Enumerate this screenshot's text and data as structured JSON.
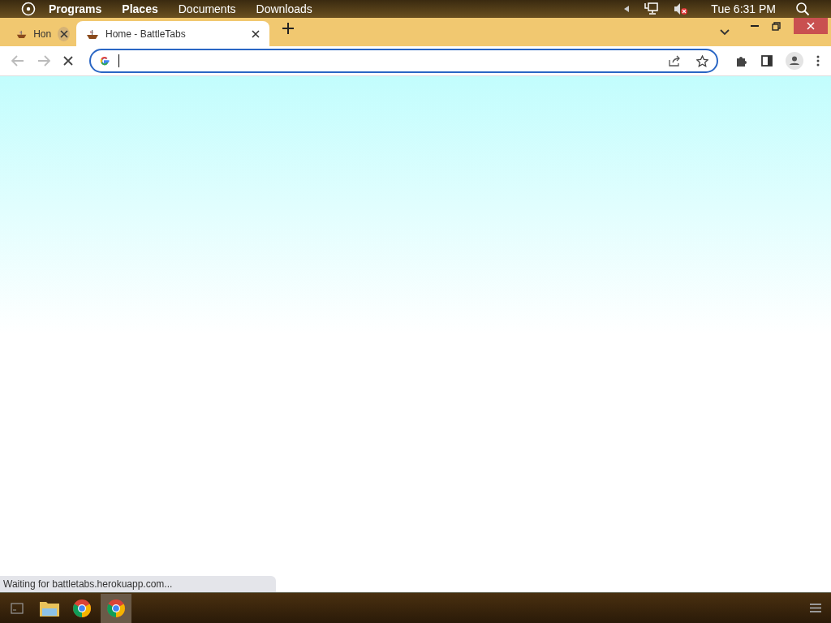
{
  "top_panel": {
    "menus": [
      "Programs",
      "Places",
      "Documents",
      "Downloads"
    ],
    "clock": "Tue 6:31 PM"
  },
  "tabs": [
    {
      "title": "Hon",
      "selected": false
    },
    {
      "title": "Home - BattleTabs",
      "selected": true
    }
  ],
  "status_bubble": "Waiting for battletabs.herokuapp.com...",
  "taskbar": [
    {
      "kind": "terminal",
      "selected": false
    },
    {
      "kind": "files",
      "selected": false
    },
    {
      "kind": "chrome",
      "selected": false
    },
    {
      "kind": "chrome",
      "selected": true
    }
  ]
}
